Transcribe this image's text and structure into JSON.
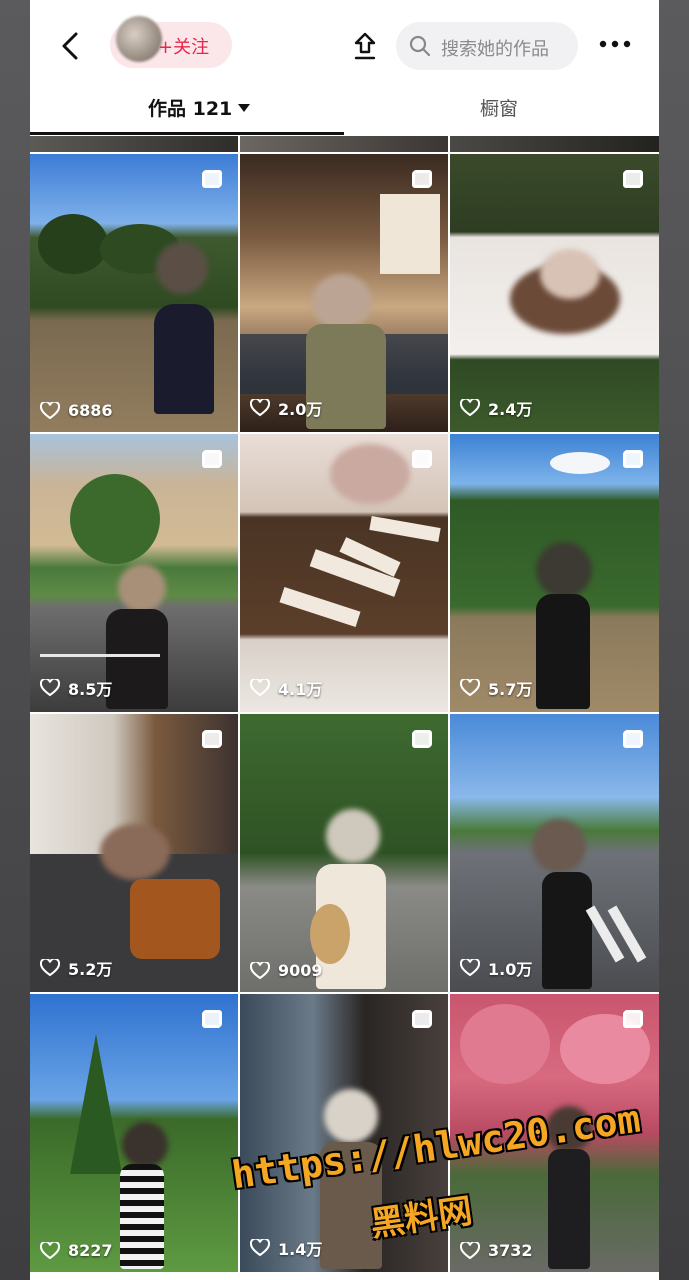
{
  "header": {
    "follow_label": "+关注",
    "search_placeholder": "搜索她的作品"
  },
  "tabs": {
    "works_label": "作品 121",
    "window_label": "橱窗"
  },
  "posts": [
    {
      "likes": "6886"
    },
    {
      "likes": "2.0万"
    },
    {
      "likes": "2.4万"
    },
    {
      "likes": "8.5万"
    },
    {
      "likes": "4.1万"
    },
    {
      "likes": "5.7万"
    },
    {
      "likes": "5.2万"
    },
    {
      "likes": "9009"
    },
    {
      "likes": "1.0万"
    },
    {
      "likes": "8227"
    },
    {
      "likes": "1.4万"
    },
    {
      "likes": "3732"
    }
  ],
  "watermark": {
    "url": "https://hlwc20.com",
    "name": "黑料网"
  }
}
